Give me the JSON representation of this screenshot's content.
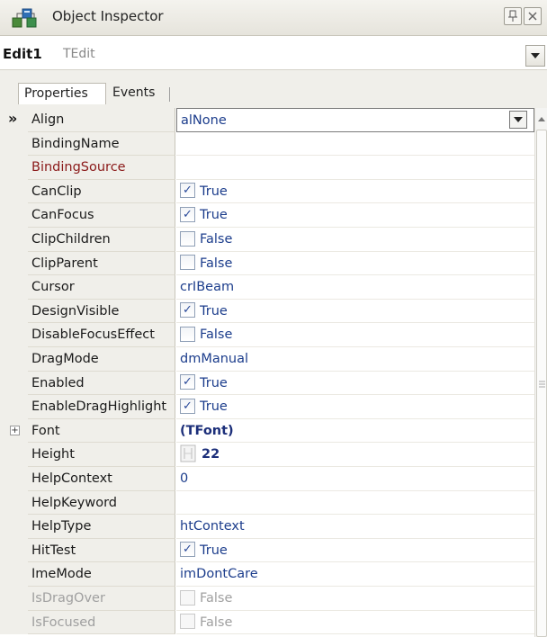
{
  "window": {
    "title": "Object Inspector",
    "icon": "object-inspector-icon",
    "buttons": [
      "pin-icon",
      "close-icon"
    ]
  },
  "component": {
    "name": "Edit1",
    "type": "TEdit"
  },
  "tabs": [
    {
      "label": "Properties",
      "active": true
    },
    {
      "label": "Events",
      "active": false
    }
  ],
  "colors": {
    "value_text": "#1c3d8c",
    "name_highlight": "#8b1a1a",
    "disabled_text": "#a0a0a0",
    "gutter_bg": "#f0efea"
  },
  "properties": [
    {
      "name": "Align",
      "value": "alNone",
      "kind": "dropdown",
      "selected": true
    },
    {
      "name": "BindingName",
      "value": "",
      "kind": "text"
    },
    {
      "name": "BindingSource",
      "value": "",
      "kind": "text",
      "highlight": true
    },
    {
      "name": "CanClip",
      "value": "True",
      "kind": "bool",
      "checked": true
    },
    {
      "name": "CanFocus",
      "value": "True",
      "kind": "bool",
      "checked": true
    },
    {
      "name": "ClipChildren",
      "value": "False",
      "kind": "bool",
      "checked": false
    },
    {
      "name": "ClipParent",
      "value": "False",
      "kind": "bool",
      "checked": false
    },
    {
      "name": "Cursor",
      "value": "crIBeam",
      "kind": "text"
    },
    {
      "name": "DesignVisible",
      "value": "True",
      "kind": "bool",
      "checked": true
    },
    {
      "name": "DisableFocusEffect",
      "value": "False",
      "kind": "bool",
      "checked": false
    },
    {
      "name": "DragMode",
      "value": "dmManual",
      "kind": "text"
    },
    {
      "name": "Enabled",
      "value": "True",
      "kind": "bool",
      "checked": true
    },
    {
      "name": "EnableDragHighlight",
      "value": "True",
      "kind": "bool",
      "checked": true
    },
    {
      "name": "Font",
      "value": "(TFont)",
      "kind": "object",
      "expandable": true
    },
    {
      "name": "Height",
      "value": "22",
      "kind": "number-spin"
    },
    {
      "name": "HelpContext",
      "value": "0",
      "kind": "text"
    },
    {
      "name": "HelpKeyword",
      "value": "",
      "kind": "text"
    },
    {
      "name": "HelpType",
      "value": "htContext",
      "kind": "text"
    },
    {
      "name": "HitTest",
      "value": "True",
      "kind": "bool",
      "checked": true
    },
    {
      "name": "ImeMode",
      "value": "imDontCare",
      "kind": "text"
    },
    {
      "name": "IsDragOver",
      "value": "False",
      "kind": "bool",
      "checked": false,
      "disabled": true
    },
    {
      "name": "IsFocused",
      "value": "False",
      "kind": "bool",
      "checked": false,
      "disabled": true
    }
  ]
}
